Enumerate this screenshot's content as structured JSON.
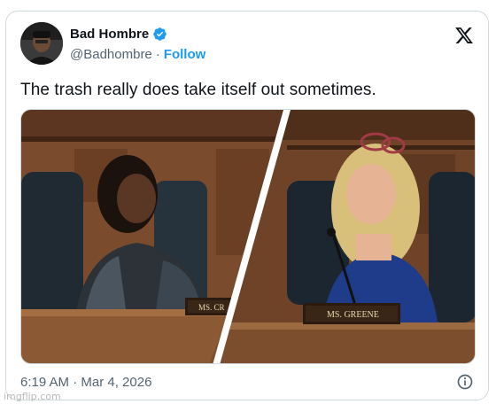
{
  "author": {
    "display_name": "Bad Hombre",
    "handle": "@Badhombre",
    "separator": "·",
    "follow_label": "Follow",
    "verified_icon": "verified-badge-icon",
    "verified_color": "#1d9bf0"
  },
  "post": {
    "text": "The trash really does take itself out sometimes.",
    "timestamp": "6:19 AM · Mar 4, 2026"
  },
  "media": {
    "left_nameplate": "MS. CR",
    "right_nameplate": "MS. GREENE"
  },
  "platform": {
    "logo_icon": "x-logo-icon",
    "info_icon": "info-icon"
  },
  "watermark": "imgflip.com"
}
